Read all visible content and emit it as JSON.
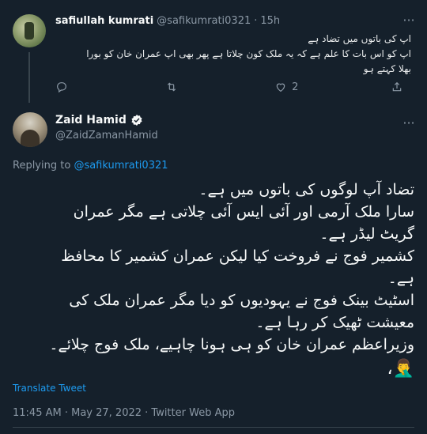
{
  "reply": {
    "name": "safiullah kumrati",
    "handle": "@safikumrati0321",
    "dot": "·",
    "time": "15h",
    "more": "···",
    "text_lines": [
      "اپ کی باتوں میں تضاد ہے",
      "اپ کو اس بات کا علم ہے کہ یہ ملک کون چلاتا ہے پھر بھی اپ عمران خان کو بورا",
      "بھلا کہتے ہو"
    ],
    "actions": {
      "reply_count": "",
      "retweet_count": "",
      "like_count": "2"
    }
  },
  "tweet": {
    "name": "Zaid Hamid",
    "handle": "@ZaidZamanHamid",
    "more": "···",
    "replying_prefix": "Replying to",
    "replying_to": "@safikumrati0321",
    "text_lines": [
      "تضاد آپ لوگوں کی باتوں میں ہے۔",
      "سارا ملک آرمی اور آئی ایس آئی چلاتی ہے مگر عمران",
      "گریٹ لیڈر ہے۔",
      "کشمیر فوج نے فروخت کیا لیکن عمران کشمیر کا محافظ",
      "ہے۔",
      "اسٹیٹ بینک فوج نے یہودیوں کو دیا مگر عمران ملک کی",
      "معیشت ٹھیک کر رہا ہے۔",
      "وزیراعظم عمران خان کو ہی ہونا چاہیے، ملک فوج چلائے۔"
    ],
    "emoji": "🤦‍♂️،",
    "translate_label": "Translate Tweet",
    "meta": "11:45 AM · May 27, 2022 · Twitter Web App"
  },
  "colors": {
    "background": "#15202b",
    "text": "#f7f9f9",
    "muted": "#8b98a5",
    "accent": "#1d9bf0",
    "border": "#38444d"
  }
}
